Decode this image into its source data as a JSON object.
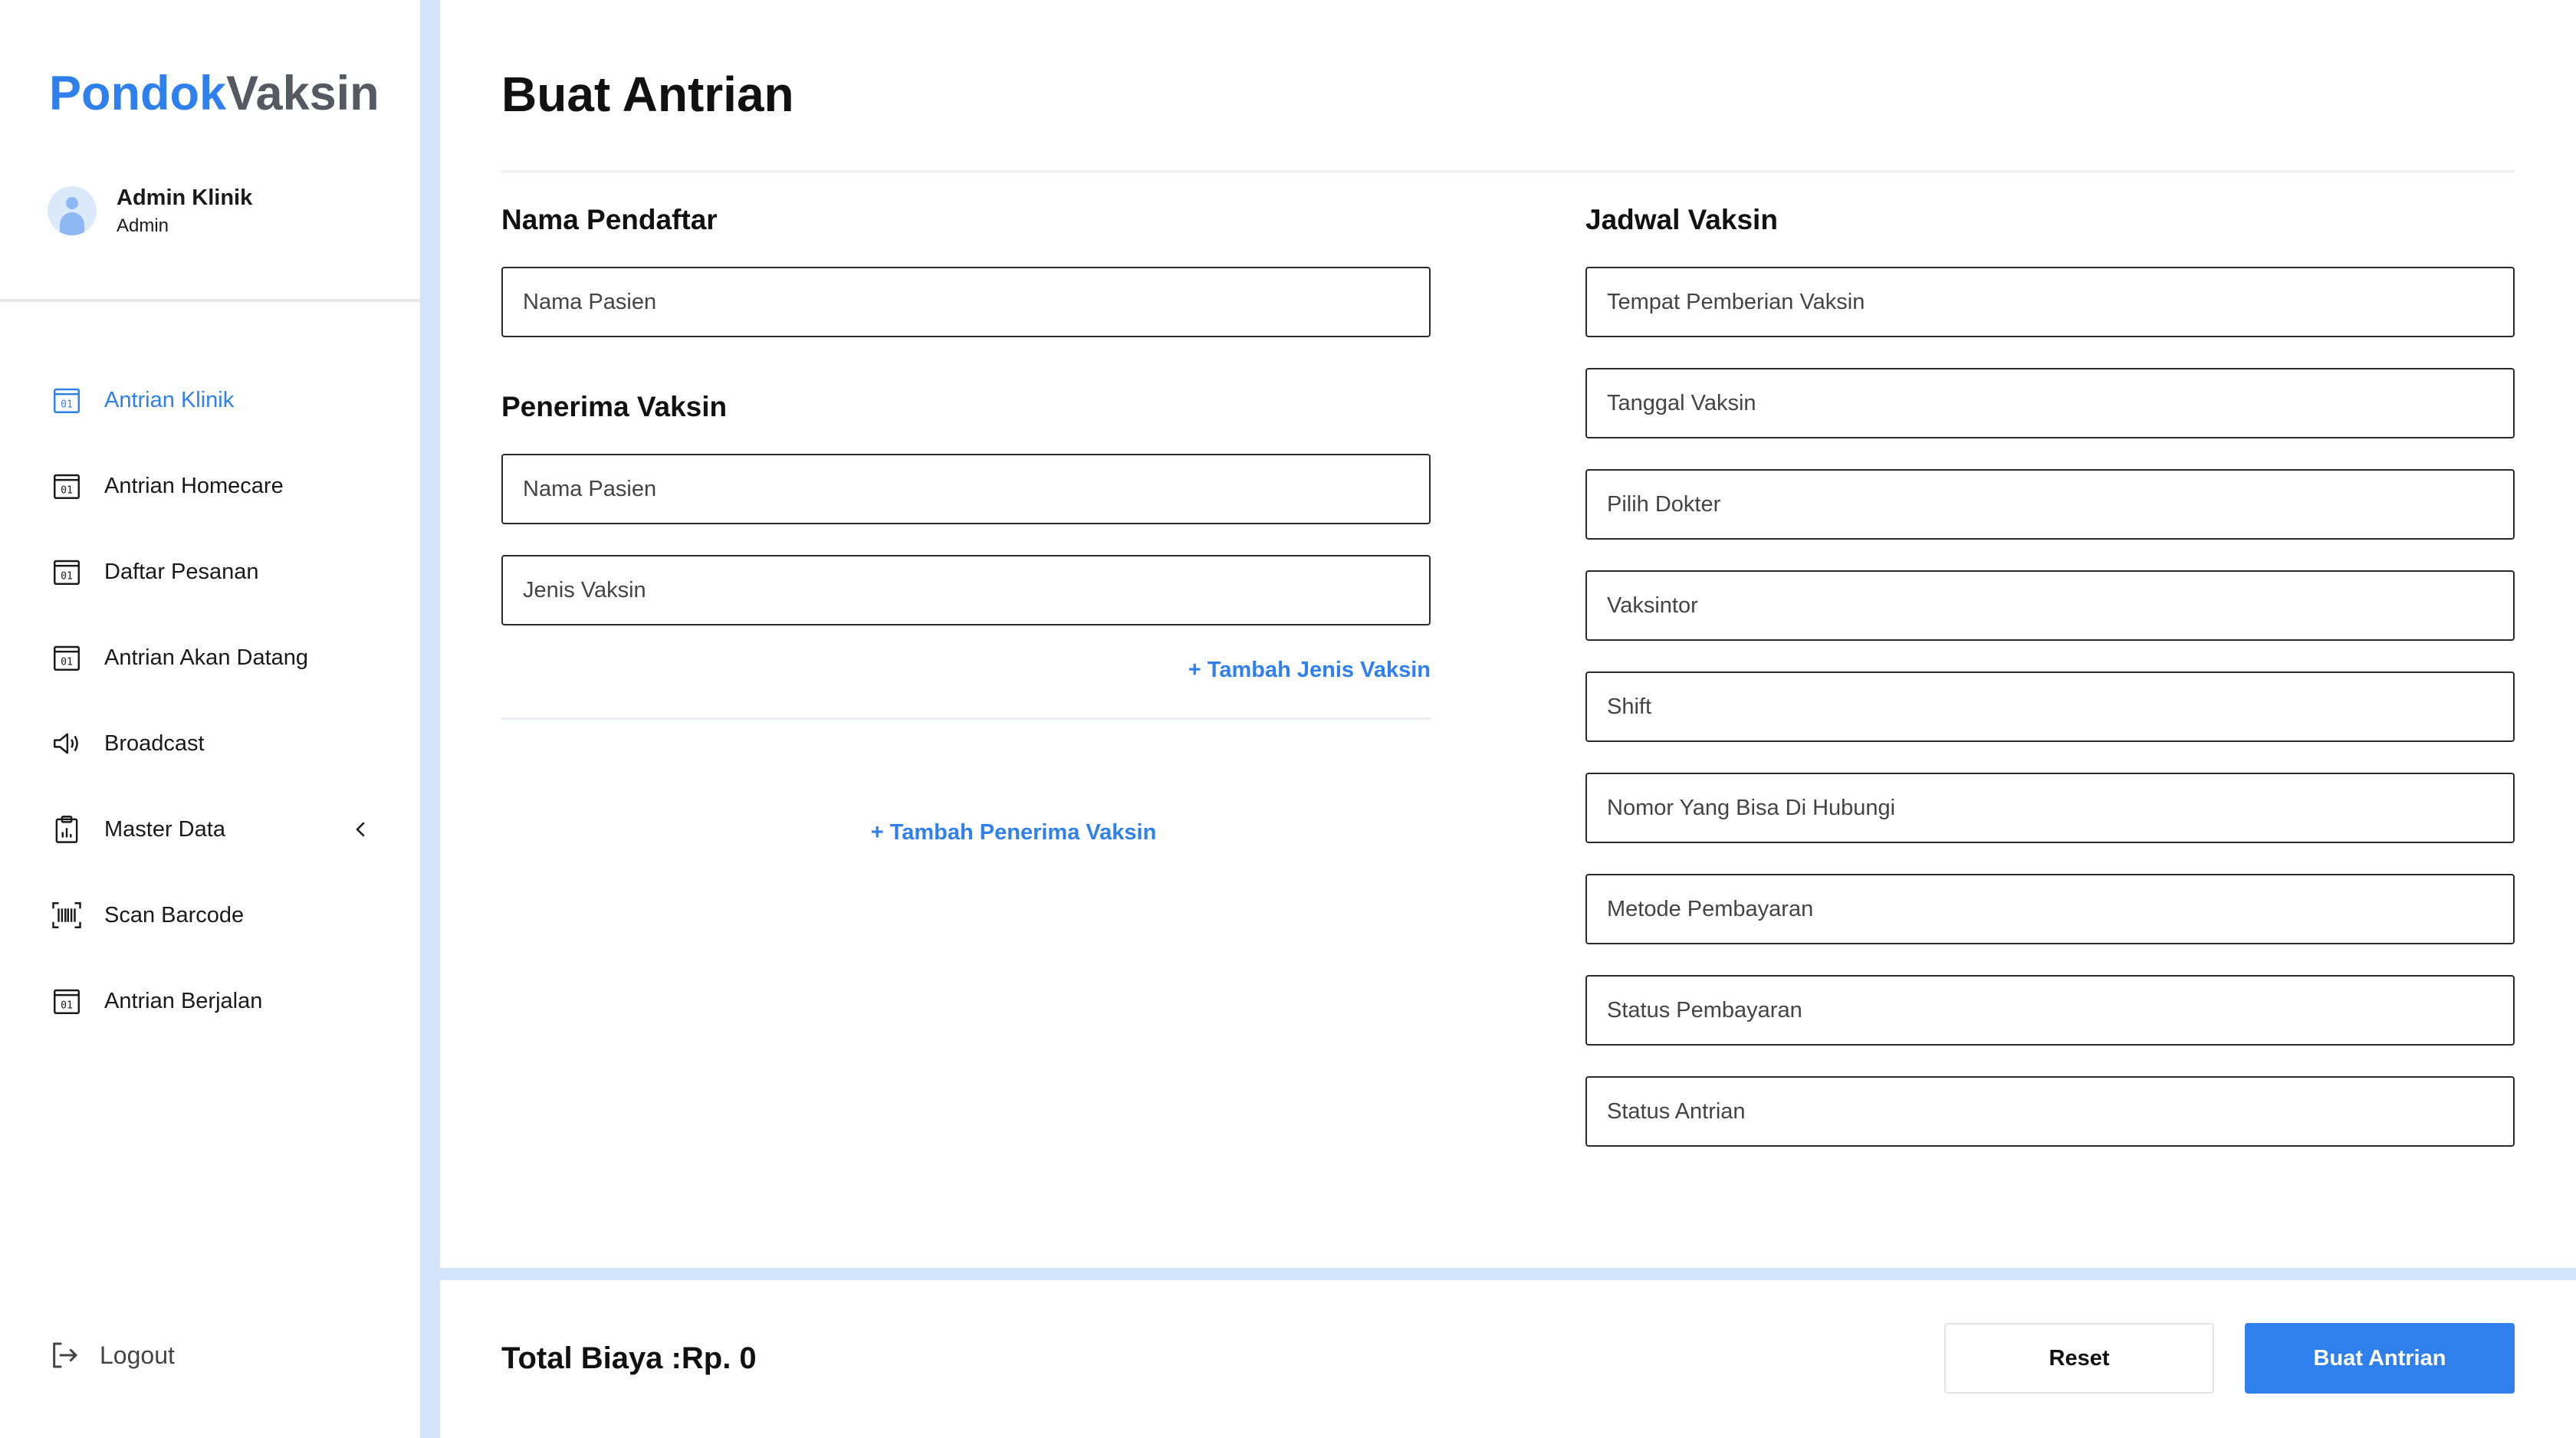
{
  "brand": {
    "part1": "Pondok",
    "part2": "Vaksin"
  },
  "user": {
    "name": "Admin Klinik",
    "role": "Admin"
  },
  "nav": {
    "items": [
      {
        "label": "Antrian Klinik"
      },
      {
        "label": "Antrian Homecare"
      },
      {
        "label": "Daftar Pesanan"
      },
      {
        "label": "Antrian Akan Datang"
      },
      {
        "label": "Broadcast"
      },
      {
        "label": "Master Data"
      },
      {
        "label": "Scan Barcode"
      },
      {
        "label": "Antrian Berjalan"
      }
    ],
    "logout": "Logout"
  },
  "page": {
    "title": "Buat Antrian"
  },
  "form": {
    "pendaftar": {
      "heading": "Nama Pendaftar",
      "name_placeholder": "Nama Pasien"
    },
    "penerima": {
      "heading": "Penerima Vaksin",
      "name_placeholder": "Nama Pasien",
      "vaccine_placeholder": "Jenis Vaksin",
      "add_vaccine_link": "+ Tambah Jenis Vaksin",
      "add_recipient_link": "+ Tambah Penerima Vaksin"
    },
    "jadwal": {
      "heading": "Jadwal Vaksin",
      "fields": [
        "Tempat Pemberian Vaksin",
        "Tanggal Vaksin",
        "Pilih Dokter",
        "Vaksintor",
        "Shift",
        "Nomor Yang Bisa Di Hubungi",
        "Metode Pembayaran",
        "Status Pembayaran",
        "Status Antrian"
      ]
    }
  },
  "footer": {
    "total_label": "Total Biaya :",
    "total_value": "Rp. 0",
    "reset_label": "Reset",
    "submit_label": "Buat Antrian"
  },
  "colors": {
    "accent": "#2f80ed",
    "strip": "#d3e4fa",
    "brand_gray": "#555a62"
  }
}
